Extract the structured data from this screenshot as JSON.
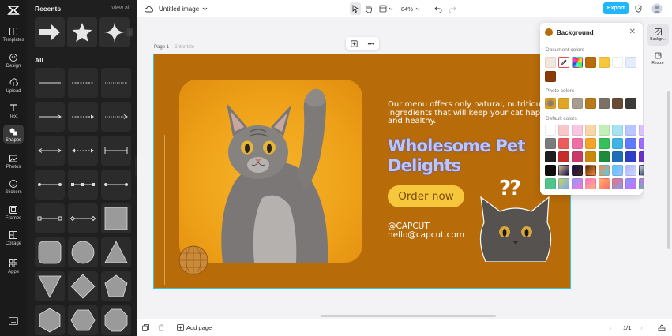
{
  "rail": {
    "items": [
      {
        "label": "Templates",
        "icon": "templates-icon"
      },
      {
        "label": "Design",
        "icon": "design-icon"
      },
      {
        "label": "Upload",
        "icon": "upload-icon"
      },
      {
        "label": "Text",
        "icon": "text-icon"
      },
      {
        "label": "Shapes",
        "icon": "shapes-icon"
      },
      {
        "label": "Photos",
        "icon": "photos-icon"
      },
      {
        "label": "Stickers",
        "icon": "stickers-icon"
      },
      {
        "label": "Frames",
        "icon": "frames-icon"
      },
      {
        "label": "Collage",
        "icon": "collage-icon"
      },
      {
        "label": "Apps",
        "icon": "apps-icon"
      }
    ],
    "active": "Shapes"
  },
  "panel": {
    "recents_label": "Recents",
    "view_all": "View all",
    "all_label": "All"
  },
  "topbar": {
    "doc_title": "Untitled image",
    "zoom": "84%",
    "export_label": "Export"
  },
  "canvas": {
    "page_label": "Page 1 -",
    "title_placeholder": "Enter title"
  },
  "design": {
    "copy": "Our menu offers only natural, nutritious\ningredients that will keep your cat happ\nand healthy.",
    "headline": "Wholesome Pet\nDelights",
    "button": "Order now",
    "contact": "@CAPCUT\nhello@capcut.com",
    "qmarks": "??",
    "bg_color": "#b76b09",
    "button_color": "#f6c73c",
    "headline_color": "#b9c6ff"
  },
  "bgpanel": {
    "title": "Background",
    "document_label": "Document colors",
    "photo_label": "Photo colors",
    "default_label": "Default colors",
    "document_colors": [
      "#f2e9dc",
      "picker",
      "rainbow",
      "#b76b09",
      "#f6c73c",
      "#ffffff",
      "#e6ecff",
      "#8a3b06"
    ],
    "photo_colors": [
      "photo",
      "#e2a423",
      "#a89c90",
      "#b8791b",
      "#7c7067",
      "#6a4a33",
      "#3e3a38"
    ],
    "default_colors": [
      [
        "#ffffff",
        "#f9c7c7",
        "#f9c7e1",
        "#f7d6a8",
        "#c2f0b8",
        "#a6e3f2",
        "#b9c6ff",
        "#d8c2ff"
      ],
      [
        "#7c7c7c",
        "#ee5b5b",
        "#ef6ea3",
        "#f4a427",
        "#34c05a",
        "#3fb4e6",
        "#5f7bff",
        "#9d6cff"
      ],
      [
        "#1f1f1f",
        "#c52d2d",
        "#c9396a",
        "#c98a0c",
        "#1f8a3a",
        "#1e6eb8",
        "#2d3fc6",
        "#6a30c9"
      ],
      [
        "#0d0d0d",
        "#d8c27a",
        "#0e0a5e",
        "#4a2c0a",
        "#ff8a3d",
        "#3dd3ff",
        "#b8b2ff",
        "#c6dcff"
      ],
      [
        "#4fc58a",
        "#c6d84f",
        "#7aa6ff",
        "#ff6fd8",
        "#ffb36b",
        "#ff6b6b",
        "#7f9bff",
        "#d26bff"
      ]
    ]
  },
  "rightrail": {
    "background_label": "Backgr...",
    "resize_label": "Resize"
  },
  "bottombar": {
    "add_page": "Add page",
    "page_count": "1/1"
  }
}
